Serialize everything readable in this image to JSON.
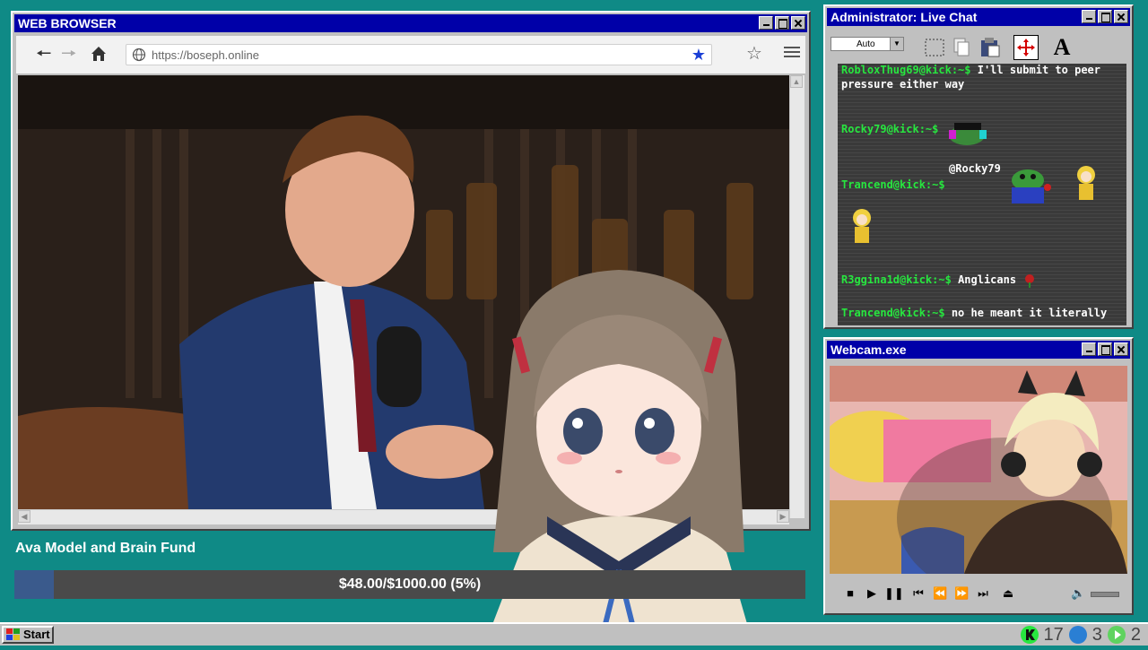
{
  "browser": {
    "title": "WEB BROWSER",
    "url": "https://boseph.online",
    "icons": [
      "back-arrow-icon",
      "forward-arrow-icon",
      "home-icon",
      "globe-icon",
      "bookmark-star-icon",
      "star-outline-icon",
      "menu-icon"
    ]
  },
  "chat": {
    "title": "Administrator: Live Chat",
    "font_select": "Auto",
    "messages": [
      {
        "user": "RobloxThug69@kick:~$",
        "text": "I'll submit to peer"
      },
      {
        "user": "",
        "text": "pressure either way"
      },
      {
        "user": "Rocky79@kick:~$",
        "text": ""
      },
      {
        "user": "",
        "text": "@Rocky79"
      },
      {
        "user": "Trancend@kick:~$",
        "text": ""
      },
      {
        "user": "R3ggina1d@kick:~$",
        "text": "Anglicans"
      },
      {
        "user": "Trancend@kick:~$",
        "text": "no he meant it literally"
      }
    ],
    "user_color": "#27e63f"
  },
  "webcam": {
    "title": "Webcam.exe"
  },
  "fund": {
    "title": "Ava Model and Brain Fund",
    "amount_text": "$48.00/$1000.00 (5%)",
    "progress": 0.05
  },
  "taskbar": {
    "start_label": "Start",
    "tray": [
      {
        "icon": "kick-icon",
        "value": "17",
        "color": "#27e63f"
      },
      {
        "icon": "moon-icon",
        "value": "3",
        "color": "#2a7fd4"
      },
      {
        "icon": "play-circle-icon",
        "value": "2",
        "color": "#5fd35f"
      }
    ]
  }
}
